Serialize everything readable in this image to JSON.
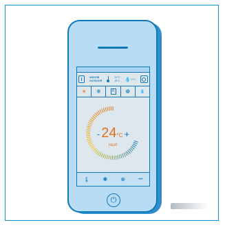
{
  "status": {
    "indoor_label": "INDOOR",
    "outdoor_label": "OUTDOOR",
    "indoor_temp": "24°C",
    "outdoor_temp": "19°C"
  },
  "modes": [
    {
      "icon": "☀",
      "name": "heat"
    },
    {
      "icon": "❄",
      "name": "cool"
    },
    {
      "icon": "A",
      "name": "auto"
    },
    {
      "icon": "❁",
      "name": "fan"
    },
    {
      "icon": "💧",
      "name": "dry"
    }
  ],
  "thermostat": {
    "minus": "-",
    "value": "24",
    "unit": "°C",
    "plus": "+",
    "mode_label": "HEAT"
  },
  "nav": {
    "home_icon": "🌡",
    "settings_icon": "✱",
    "timer_icon": "⊕",
    "more_icon": "•••"
  },
  "power_icon": "⏻",
  "colors": {
    "accent": "#0f78b7",
    "heat": "#e0701c",
    "frame": "#0a8fd6"
  }
}
